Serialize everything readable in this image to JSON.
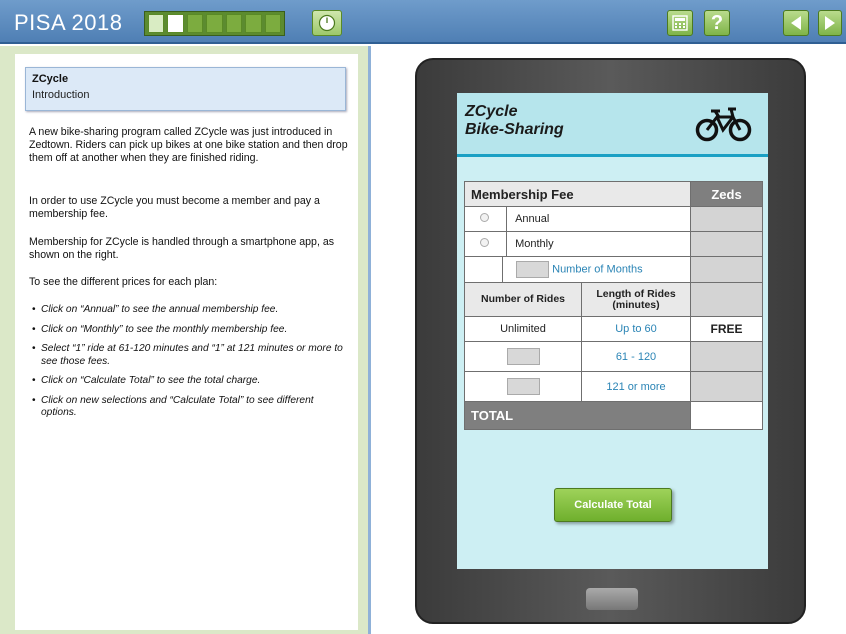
{
  "header": {
    "title": "PISA 2018",
    "progress": {
      "total_units": 7,
      "current_unit": 2
    }
  },
  "left_panel": {
    "heading": "ZCycle",
    "subheading": "Introduction",
    "paragraphs": [
      "A new bike-sharing program called ZCycle was just introduced in Zedtown. Riders can pick up bikes at one bike station and then drop them off at another when they are finished riding.",
      "In order to use ZCycle you must become a member and pay a membership fee.",
      "Membership for ZCycle is handled through a smartphone app, as shown on the right.",
      "To see the different prices for each plan:"
    ],
    "bullets": [
      "Click on “Annual” to see the annual membership fee.",
      "Click on “Monthly” to see the monthly membership fee.",
      "Select “1” ride at 61-120 minutes and “1” at 121 minutes or more to see those fees.",
      "Click on “Calculate Total” to see the total charge.",
      "Click on new selections and “Calculate Total” to see different options."
    ]
  },
  "app": {
    "title_line1": "ZCycle",
    "title_line2": "Bike-Sharing",
    "table": {
      "membership_header": "Membership Fee",
      "zeds_header": "Zeds",
      "annual_label": "Annual",
      "monthly_label": "Monthly",
      "months_label": "Number of Months",
      "rides_header": "Number of Rides",
      "length_header_line1": "Length of Rides",
      "length_header_line2": "(minutes)",
      "unlimited_label": "Unlimited",
      "up_to_60": "Up to 60",
      "free_label": "FREE",
      "range_61_120": "61 - 120",
      "range_121_more": "121 or more",
      "total_label": "TOTAL"
    },
    "calculate_button": "Calculate Total"
  },
  "colors": {
    "topbar": "#5b8cc1",
    "progress_green": "#7cac3f",
    "screen_bg": "#cdeff3",
    "accent_blue": "#2a84b5",
    "button_green": "#85c143"
  }
}
